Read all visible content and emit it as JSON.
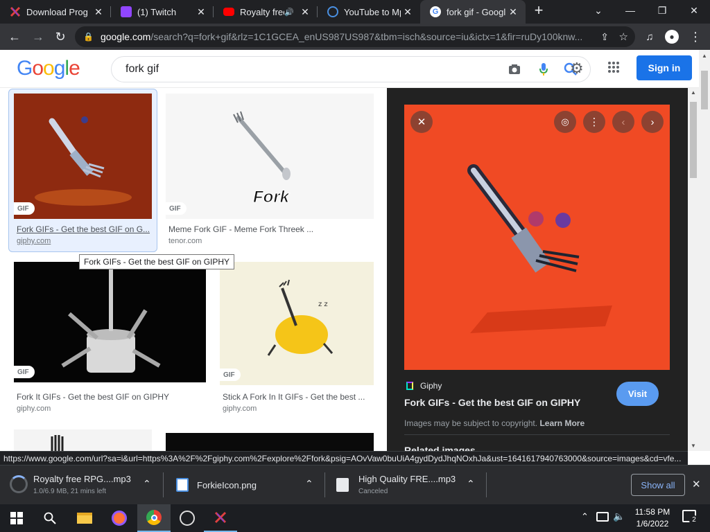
{
  "tabs": [
    {
      "title": "Download Prog",
      "icon": "x-game-icon",
      "color": "#e04040"
    },
    {
      "title": "(1) Twitch",
      "icon": "twitch-icon",
      "color": "#9146ff"
    },
    {
      "title": "Royalty free",
      "icon": "youtube-icon",
      "color": "#ff0000"
    },
    {
      "title": "YouTube to Mp",
      "icon": "converter-icon",
      "color": "#4a90e2"
    },
    {
      "title": "fork gif - Googl",
      "icon": "google-icon",
      "color": "#4285f4"
    }
  ],
  "address": {
    "domain": "google.com",
    "path": "/search?q=fork+gif&rlz=1C1GCEA_enUS987US987&tbm=isch&source=iu&ictx=1&fir=ruDy100knw..."
  },
  "google": {
    "logo_letters": [
      {
        "ch": "G",
        "color": "#4285f4"
      },
      {
        "ch": "o",
        "color": "#ea4335"
      },
      {
        "ch": "o",
        "color": "#fbbc05"
      },
      {
        "ch": "g",
        "color": "#4285f4"
      },
      {
        "ch": "l",
        "color": "#34a853"
      },
      {
        "ch": "e",
        "color": "#ea4335"
      }
    ],
    "query": "fork gif",
    "signin": "Sign in"
  },
  "results": [
    {
      "title": "Fork GIFs - Get the best GIF on G...",
      "source": "giphy.com",
      "badge": "GIF"
    },
    {
      "title": "Meme Fork GIF - Meme Fork Threek ...",
      "source": "tenor.com",
      "badge": "GIF",
      "overlay": "Fork"
    },
    {
      "title": "Fork It GIFs - Get the best GIF on GIPHY",
      "source": "giphy.com",
      "badge": "GIF"
    },
    {
      "title": "Stick A Fork In It GIFs - Get the best ...",
      "source": "giphy.com",
      "badge": "GIF"
    }
  ],
  "tooltip": "Fork GIFs - Get the best GIF on GIPHY",
  "preview": {
    "source": "Giphy",
    "title": "Fork GIFs - Get the best GIF on GIPHY",
    "visit": "Visit",
    "copyright": "Images may be subject to copyright.",
    "learn_more": "Learn More",
    "related": "Related images"
  },
  "status_url": "https://www.google.com/url?sa=i&url=https%3A%2F%2Fgiphy.com%2Fexplore%2Ffork&psig=AOvVaw0buUiA4gydDydJhqNOxhJa&ust=1641617940763000&source=images&cd=vfe...",
  "downloads": [
    {
      "name": "Royalty free RPG....mp3",
      "status": "1.0/6.9 MB, 21 mins left"
    },
    {
      "name": "ForkieIcon.png",
      "status": ""
    },
    {
      "name": "High Quality FRE....mp3",
      "status": "Canceled"
    }
  ],
  "show_all": "Show all",
  "clock": {
    "time": "11:58 PM",
    "date": "1/6/2022"
  },
  "notifications": "2"
}
